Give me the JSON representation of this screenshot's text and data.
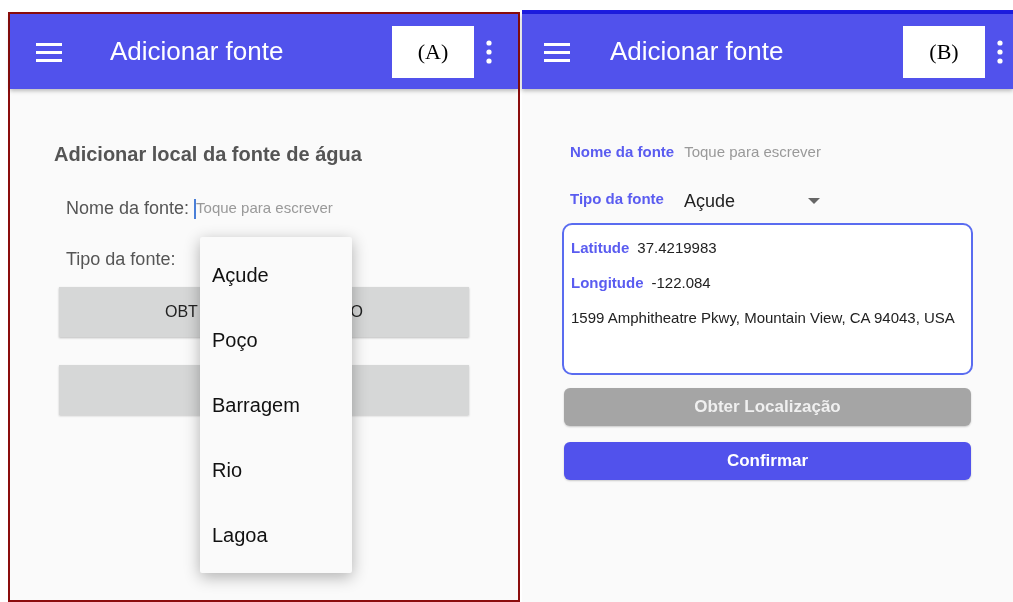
{
  "screen_a": {
    "figure_label": "(A)",
    "app_bar": {
      "title": "Adicionar fonte"
    },
    "heading": "Adicionar local da fonte de água",
    "name_field": {
      "label": "Nome da fonte:",
      "placeholder": "Toque para escrever"
    },
    "type_field": {
      "label": "Tipo da fonte:"
    },
    "location_button": {
      "label_left": "OBT",
      "label_right": "O"
    },
    "dropdown_menu": {
      "items": [
        {
          "label": "Açude"
        },
        {
          "label": "Poço"
        },
        {
          "label": "Barragem"
        },
        {
          "label": "Rio"
        },
        {
          "label": "Lagoa"
        }
      ]
    }
  },
  "screen_b": {
    "figure_label": "(B)",
    "app_bar": {
      "title": "Adicionar fonte"
    },
    "name_field": {
      "label": "Nome da fonte",
      "placeholder": "Toque para escrever"
    },
    "type_field": {
      "label": "Tipo da fonte",
      "value": "Açude"
    },
    "location_box": {
      "latitude_label": "Latitude",
      "latitude": "37.4219983",
      "longitude_label": "Longitude",
      "longitude": "-122.084",
      "address": "1599 Amphitheatre Pkwy, Mountain View, CA 94043, USA"
    },
    "buttons": [
      {
        "label": "Obter Localização",
        "disabled": true
      },
      {
        "label": "Confirmar",
        "disabled": false
      }
    ]
  }
}
